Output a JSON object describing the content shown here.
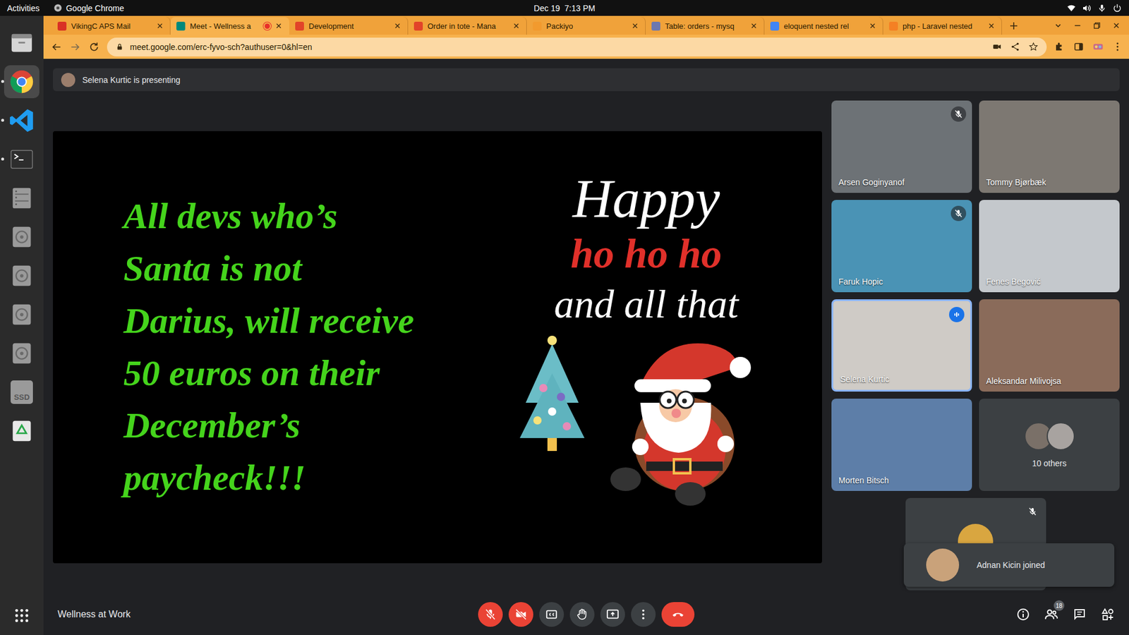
{
  "topbar": {
    "activities": "Activities",
    "app": "Google Chrome",
    "clock": "Dec 19  7:13 PM"
  },
  "dock": [
    {
      "kind": "files",
      "running": false,
      "active": false,
      "label": ""
    },
    {
      "kind": "chrome",
      "running": true,
      "active": true,
      "label": ""
    },
    {
      "kind": "vscode",
      "running": true,
      "active": false,
      "label": ""
    },
    {
      "kind": "terminal",
      "running": true,
      "active": false,
      "label": ""
    },
    {
      "kind": "cabinet",
      "running": false,
      "active": false,
      "label": ""
    },
    {
      "kind": "drive",
      "running": false,
      "active": false,
      "label": ""
    },
    {
      "kind": "drive",
      "running": false,
      "active": false,
      "label": ""
    },
    {
      "kind": "drive",
      "running": false,
      "active": false,
      "label": ""
    },
    {
      "kind": "drive",
      "running": false,
      "active": false,
      "label": ""
    },
    {
      "kind": "ssd",
      "running": false,
      "active": false,
      "label": "SSD"
    },
    {
      "kind": "trash",
      "running": false,
      "active": false,
      "label": ""
    }
  ],
  "tabs": [
    {
      "label": "VikingC APS Mail",
      "selected": false,
      "recording": false,
      "color": "#d93025"
    },
    {
      "label": "Meet - Wellness a",
      "selected": true,
      "recording": true,
      "color": "#00897b"
    },
    {
      "label": "Development",
      "selected": false,
      "recording": false,
      "color": "#e24329"
    },
    {
      "label": "Order in tote - Mana",
      "selected": false,
      "recording": false,
      "color": "#e24329"
    },
    {
      "label": "Packiyo",
      "selected": false,
      "recording": false,
      "color": "#f29a2e"
    },
    {
      "label": "Table: orders - mysq",
      "selected": false,
      "recording": false,
      "color": "#6c78af"
    },
    {
      "label": "eloquent nested rel",
      "selected": false,
      "recording": false,
      "color": "#4285f4"
    },
    {
      "label": "php - Laravel nested",
      "selected": false,
      "recording": false,
      "color": "#f48024"
    }
  ],
  "address": {
    "url": "meet.google.com/erc-fyvo-sch?authuser=0&hl=en"
  },
  "meet": {
    "presenting": "Selena Kurtic is presenting",
    "title": "Wellness at Work",
    "people_badge": "18"
  },
  "slide": {
    "lines": [
      "All devs who’s",
      "Santa is not",
      "Darius, will receive",
      "50 euros on their",
      "December’s",
      "paycheck!!!"
    ],
    "happy": "Happy",
    "ho": "ho ho ho",
    "tail": "and all that"
  },
  "participants": [
    {
      "name": "Arsen Goginyanof",
      "muted": true,
      "speaking": false,
      "color": "#6d7276"
    },
    {
      "name": "Tommy Bjørbæk",
      "muted": false,
      "speaking": false,
      "color": "#7d7872"
    },
    {
      "name": "Faruk Hopic",
      "muted": true,
      "speaking": false,
      "color": "#4a93b5"
    },
    {
      "name": "Fenes Begović",
      "muted": false,
      "speaking": false,
      "color": "#c4c8cc"
    },
    {
      "name": "Selena Kurtic",
      "muted": false,
      "speaking": true,
      "color": "#cfcbc6"
    },
    {
      "name": "Aleksandar Milivojsa",
      "muted": false,
      "speaking": false,
      "color": "#8a6b5a"
    },
    {
      "name": "Morten Bitsch",
      "muted": false,
      "speaking": false,
      "color": "#5d7ea8"
    }
  ],
  "others": {
    "label": "10 others"
  },
  "extra_tile": {
    "muted": true
  },
  "toast": {
    "text": "Adnan Kicin joined"
  },
  "controls": [
    {
      "kind": "mic",
      "on": false
    },
    {
      "kind": "camera",
      "on": false
    },
    {
      "kind": "captions",
      "on": false
    },
    {
      "kind": "hand",
      "on": false
    },
    {
      "kind": "present",
      "on": false
    },
    {
      "kind": "more",
      "on": false
    },
    {
      "kind": "leave",
      "on": false
    }
  ]
}
